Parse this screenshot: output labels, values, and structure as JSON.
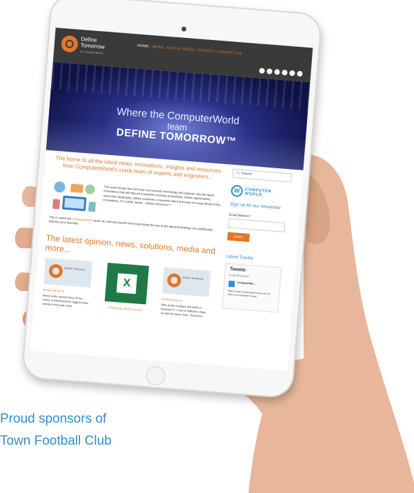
{
  "header": {
    "logo_line1": "Define",
    "logo_line2": "Tomorrow",
    "logo_sub": "by ComputerWorld",
    "nav_home": "HOME",
    "nav_rest": " / NEWS, BLOG & MEDIA / EVENTS / CONTACT US"
  },
  "hero": {
    "line1": "Where the ComputerWorld",
    "line2": "team",
    "line3": "DEFINE TOMORROW™"
  },
  "intro": {
    "headline": "The home to all the latest news, innovations, insights and resources from ComputerWorld's crack team of experts and engineers...",
    "paragraph1": "The world moves fast and only one business technology site explores only the latest innovations that will help your business increase productivity, realise opportunities, overcome challenges, satisfy customers, maximise talent and keep one step ahead of the competition. Or in other words... Define Tomorrow™.",
    "paragraph2_pre": "This is where the ",
    "paragraph2_link": "ComputerWorld",
    "paragraph2_post": " team run wild and explore how maximising the use of the latest technology can significantly improve your business."
  },
  "latest": {
    "headline": "The latest opinion, news, solutions, media and more...",
    "cards": [
      {
        "thumb_text": "Define Tomorrow",
        "title": "DoTech Brief #2",
        "body": "Below is the second issue of the series, summarising the biggest news articles of the past week."
      },
      {
        "caption": "Producing charts in excel"
      },
      {
        "thumb_text": "Define Tomorrow",
        "title": "DoTech Brief #1",
        "body": "With all the changes and shifts in Business IT, it can be difficult to keep up with the latest news. Therefore I"
      }
    ]
  },
  "sidebar": {
    "search_placeholder": "Search",
    "cw_logo_line1": "COMPUTER",
    "cw_logo_line2": "WORLD",
    "signup": "Sign up for our newsletter",
    "email_label": "Email Address *",
    "submit_label": "SUBMIT",
    "tweets_heading": "Latest Tweets",
    "tweets_title": "Tweets",
    "tweets_handle": "by @CWGroupUK",
    "tweet_author": "ComputerWo...",
    "tweet_text": "Want to learn & Microsoft Surface Pro 4? Enter our competition today!"
  },
  "caption": {
    "line1": "Proud sponsors of",
    "line2": "Town Football Club"
  },
  "colors": {
    "accent_orange": "#e0782a",
    "accent_blue": "#2f8fd0",
    "header_dark": "#3a3a3a"
  }
}
